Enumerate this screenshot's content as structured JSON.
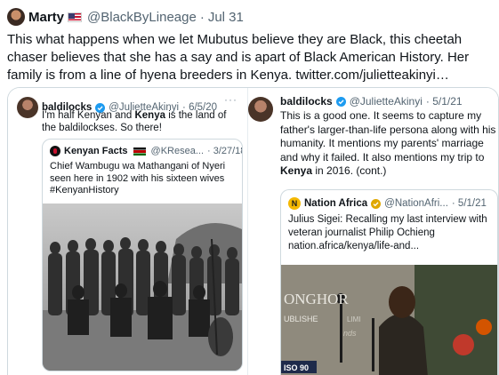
{
  "tweet": {
    "author_name": "Marty",
    "handle": "@BlackByLineage",
    "separator": "·",
    "date": "Jul 31",
    "text": "This what happens when we let Mubutus believe they are Black, this cheetah chaser believes that she has a say and is apart of Black American History. Her family is from a line of hyena breeders in Kenya.  twitter.com/julietteakinyi…"
  },
  "left_post": {
    "author_name": "baldilocks",
    "handle": "@JulietteAkinyi",
    "date": "· 6/5/20",
    "more": "···",
    "text_before": "I'm half Kenyan and ",
    "text_bold": "Kenya",
    "text_after": " is the land of the baldilockses. So there!",
    "quoted": {
      "author_name": "Kenyan Facts",
      "handle": "@KResea...",
      "date": "· 3/27/18",
      "text": "Chief Wambugu wa Mathangani of Nyeri seen here in 1902 with his sixteen wives #KenyanHistory"
    }
  },
  "right_post": {
    "author_name": "baldilocks",
    "handle": "@JulietteAkinyi",
    "date": "· 5/1/21",
    "text_before": "This is a good one. It seems to capture my father's larger-than-life persona along with his humanity.  It mentions my parents' marriage and why it failed. It also mentions my trip to ",
    "text_bold": "Kenya",
    "text_after": " in 2016. (cont.)",
    "quoted": {
      "author_name": "Nation Africa",
      "handle": "@NationAfri...",
      "date": "· 5/1/21",
      "icon_letter": "N",
      "text": "Julius Sigei: Recalling my last interview with veteran journalist Philip Ochieng nation.africa/kenya/life-and..."
    },
    "photo_sign": {
      "line1": "ONGHOR",
      "line2": "UBLISHE",
      "line3": "LIMI",
      "line4": "nds",
      "line5": "ISO 90"
    }
  },
  "colors": {
    "text": "#0f1419",
    "muted": "#536471",
    "border": "#cfd9de",
    "verified": "#1d9bf0"
  }
}
